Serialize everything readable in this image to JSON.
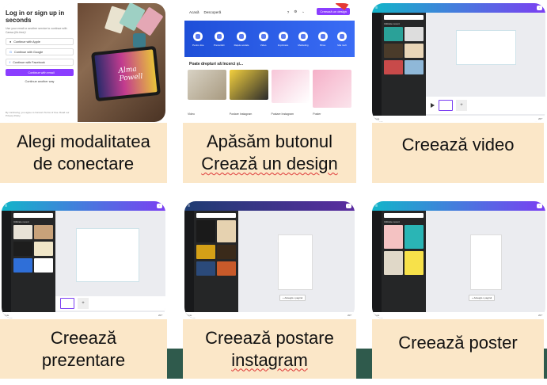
{
  "captions": [
    {
      "lines": [
        "Alegi modalitatea",
        "de conectare"
      ]
    },
    {
      "lines": [
        "Apăsăm butonul",
        "Crează un design"
      ]
    },
    {
      "lines": [
        "Creează video"
      ]
    },
    {
      "lines": [
        "Creează",
        "prezentare"
      ]
    },
    {
      "lines": [
        "Creează postare",
        "instagram"
      ]
    },
    {
      "lines": [
        "Creează poster"
      ]
    }
  ],
  "login": {
    "title": "Log in or sign up in seconds",
    "subtitle": "Use your email or another service to continue with Canva (it's free)!",
    "buttons": [
      "Continue with Apple",
      "Continue with Google",
      "Continue with Facebook"
    ],
    "primary": "Continue with email",
    "other": "Continue another way",
    "footer": "By continuing, you agree to Canva's Terms of Use. Read our Privacy Policy.",
    "tablet_text": "Alma Powell"
  },
  "home": {
    "nav": [
      "Acasă",
      "Descoperă"
    ],
    "create_button": "Creează un design",
    "banner_items": [
      "Pentru tine",
      "Prezentări",
      "Rețele sociale",
      "Video",
      "Imprimare",
      "Marketing",
      "Birou",
      "Mai mult"
    ],
    "section_title": "Poate drepturi să încerci și...",
    "thumb_labels": [
      "Video",
      "Postare Instagram",
      "Postare Instagram",
      "Poster"
    ]
  },
  "editor_labels": {
    "recent": "Utilizate recent",
    "add_page": "+ Adaugă o pagină",
    "notes": "Note",
    "zoom": "20%"
  },
  "colors": {
    "caption_bg": "#fbe7c8",
    "accent": "#8b3dff",
    "strip": "#2f5a4c"
  }
}
